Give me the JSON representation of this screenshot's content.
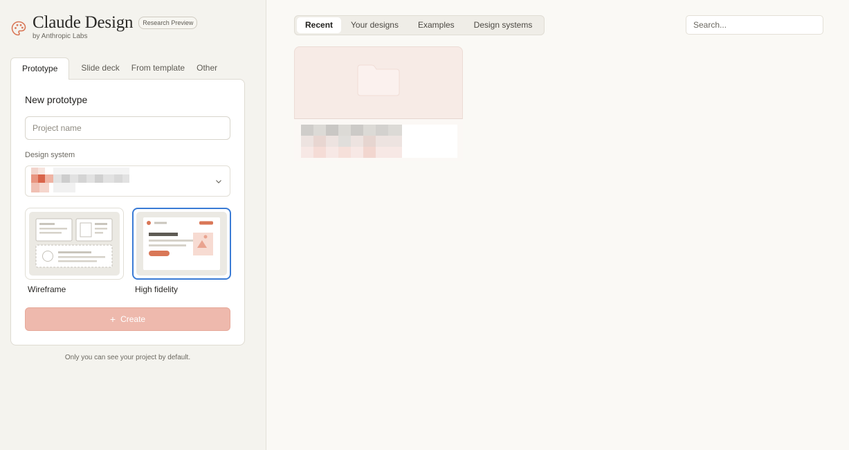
{
  "brand": {
    "title": "Claude Design",
    "badge": "Research Preview",
    "subtitle": "by Anthropic Labs",
    "icon": "palette-icon",
    "accent": "#d97757"
  },
  "create_tabs": [
    {
      "label": "Prototype",
      "active": true
    },
    {
      "label": "Slide deck",
      "active": false
    },
    {
      "label": "From template",
      "active": false
    },
    {
      "label": "Other",
      "active": false
    }
  ],
  "form": {
    "title": "New prototype",
    "project_name_placeholder": "Project name",
    "design_system_label": "Design system",
    "fidelity_options": [
      {
        "label": "Wireframe",
        "selected": false
      },
      {
        "label": "High fidelity",
        "selected": true
      }
    ],
    "create_label": "Create",
    "create_icon": "plus-icon",
    "privacy_note": "Only you can see your project by default."
  },
  "nav": {
    "tabs": [
      {
        "label": "Recent",
        "active": true
      },
      {
        "label": "Your designs",
        "active": false
      },
      {
        "label": "Examples",
        "active": false
      },
      {
        "label": "Design systems",
        "active": false
      }
    ],
    "search_placeholder": "Search..."
  },
  "colors": {
    "selected_border": "#3a7bd5",
    "create_button": "#eeb9ad"
  }
}
